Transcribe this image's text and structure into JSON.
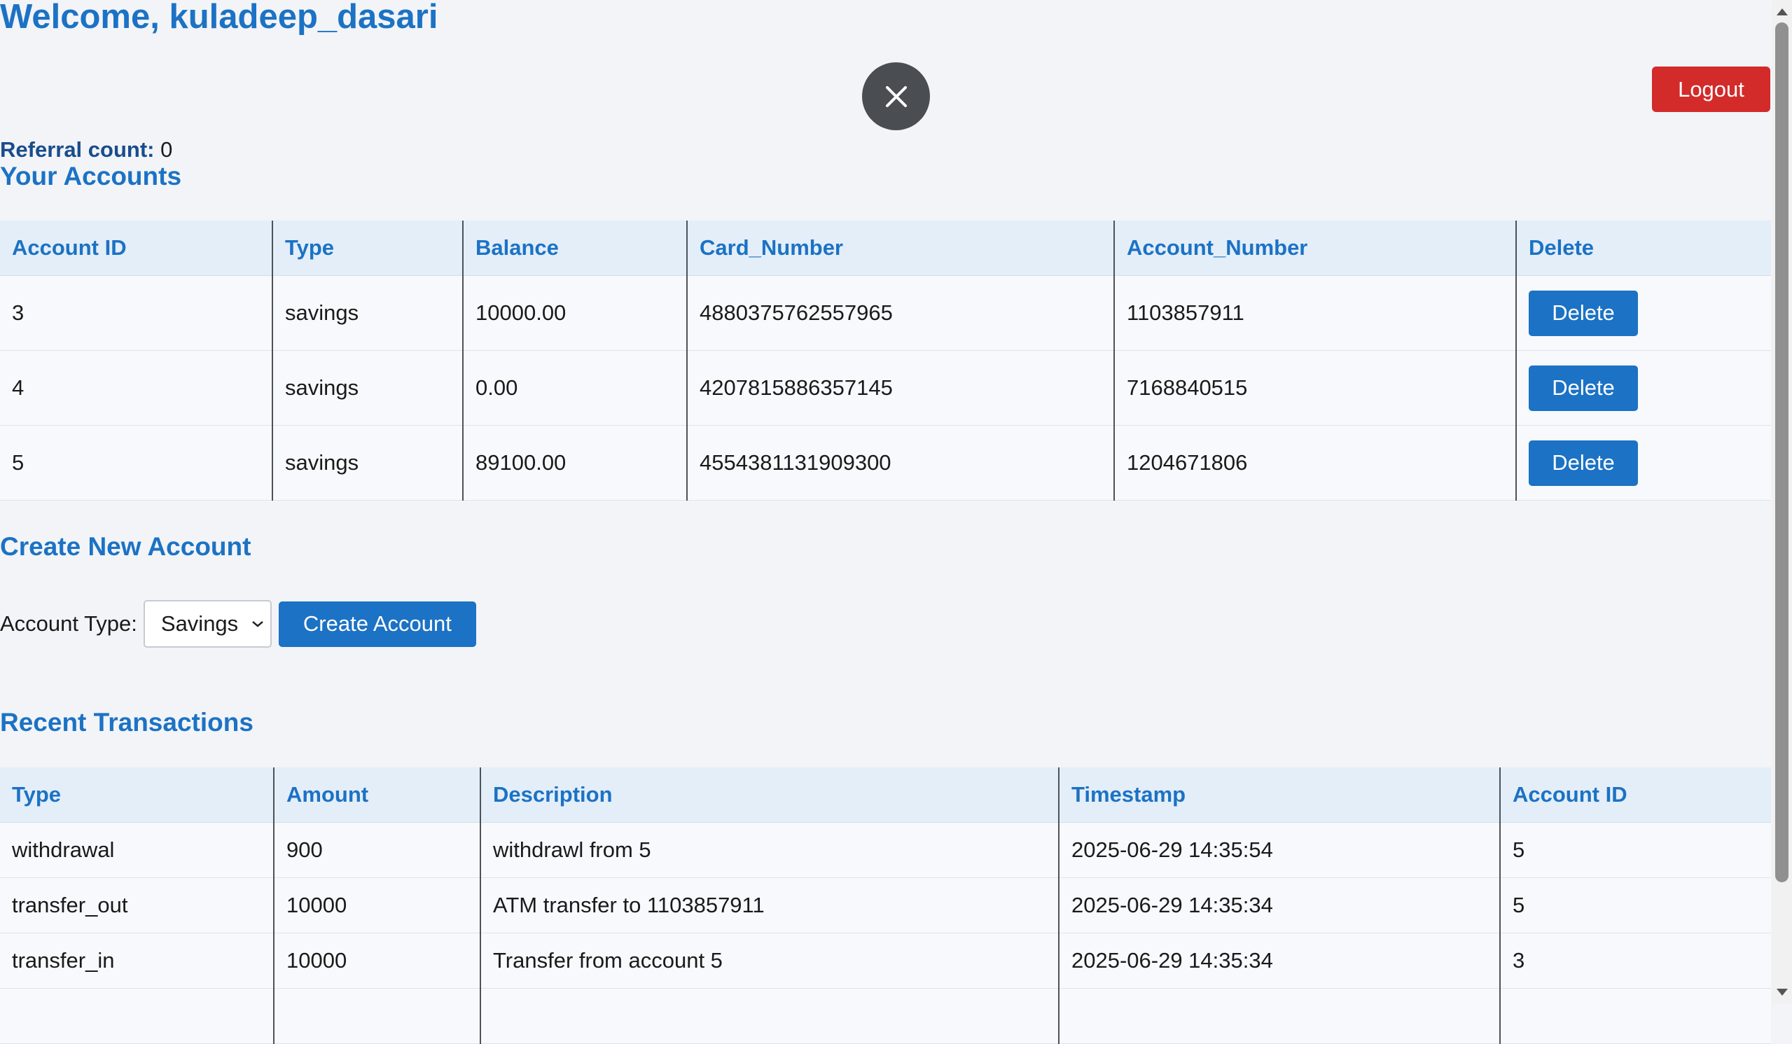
{
  "header": {
    "welcome": "Welcome, kuladeep_dasari",
    "logout_label": "Logout"
  },
  "referral": {
    "label": "Referral count:",
    "value": "0"
  },
  "accounts": {
    "title": "Your Accounts",
    "columns": [
      "Account ID",
      "Type",
      "Balance",
      "Card_Number",
      "Account_Number",
      "Delete"
    ],
    "rows": [
      {
        "id": "3",
        "type": "savings",
        "balance": "10000.00",
        "card": "4880375762557965",
        "account": "1103857911",
        "delete": "Delete"
      },
      {
        "id": "4",
        "type": "savings",
        "balance": "0.00",
        "card": "4207815886357145",
        "account": "7168840515",
        "delete": "Delete"
      },
      {
        "id": "5",
        "type": "savings",
        "balance": "89100.00",
        "card": "4554381131909300",
        "account": "1204671806",
        "delete": "Delete"
      }
    ]
  },
  "create": {
    "title": "Create New Account",
    "type_label": "Account Type:",
    "selected_type": "Savings",
    "button_label": "Create Account"
  },
  "transactions": {
    "title": "Recent Transactions",
    "columns": [
      "Type",
      "Amount",
      "Description",
      "Timestamp",
      "Account ID"
    ],
    "rows": [
      {
        "type": "withdrawal",
        "amount": "900",
        "description": "withdrawl from 5",
        "timestamp": "2025-06-29 14:35:54",
        "account_id": "5"
      },
      {
        "type": "transfer_out",
        "amount": "10000",
        "description": "ATM transfer to 1103857911",
        "timestamp": "2025-06-29 14:35:34",
        "account_id": "5"
      },
      {
        "type": "transfer_in",
        "amount": "10000",
        "description": "Transfer from account 5",
        "timestamp": "2025-06-29 14:35:34",
        "account_id": "3"
      }
    ]
  },
  "icons": {
    "close": "close-icon",
    "dropdown": "chevron-down-icon"
  },
  "colors": {
    "accent": "#1c72c4",
    "danger": "#d32a2a",
    "close_bg": "#4a4d52"
  }
}
